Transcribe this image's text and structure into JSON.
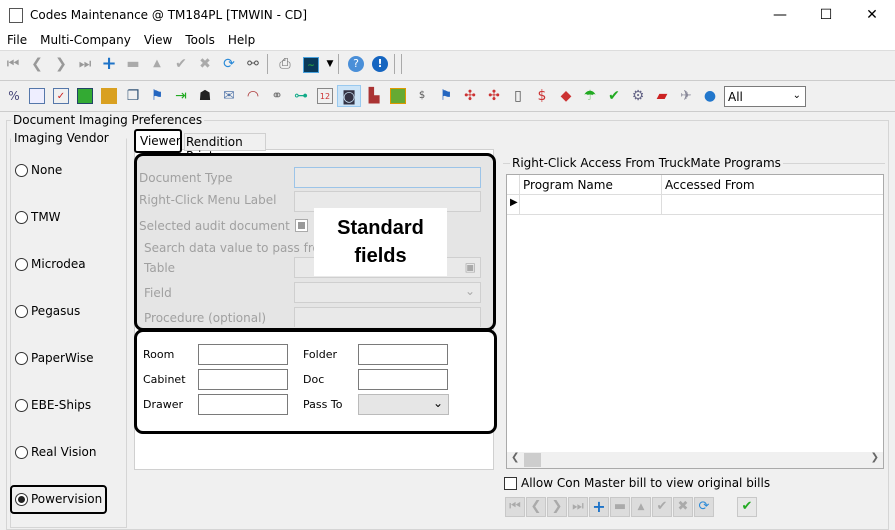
{
  "window": {
    "title": "Codes Maintenance @ TM184PL [TMWIN - CD]",
    "minimize": "—",
    "maximize": "☐",
    "close": "✕"
  },
  "menu": [
    "File",
    "Multi-Company",
    "View",
    "Tools",
    "Help"
  ],
  "toolbar2": {
    "filter_value": "All"
  },
  "group_title": "Document Imaging Preferences",
  "vendor": {
    "title": "Imaging Vendor",
    "options": [
      "None",
      "TMW",
      "Microdea",
      "Pegasus",
      "PaperWise",
      "EBE-Ships",
      "Real Vision",
      "Powervision"
    ],
    "selected": "Powervision"
  },
  "tabs": [
    "Viewer",
    "Rendition Print"
  ],
  "viewer": {
    "document_type": "Document Type",
    "menu_label": "Right-Click Menu Label",
    "selected_audit": "Selected audit document",
    "search_title": "Search data value to pass from TruckMate",
    "table": "Table",
    "field": "Field",
    "procedure": "Procedure (optional)",
    "annotation": "Standard fields",
    "room": "Room",
    "cabinet": "Cabinet",
    "drawer": "Drawer",
    "folder": "Folder",
    "doc": "Doc",
    "pass_to": "Pass To"
  },
  "right_click": {
    "title": "Right-Click Access From TruckMate Programs",
    "columns": [
      "Program Name",
      "Accessed From"
    ]
  },
  "allow_con_master": {
    "label": "Allow Con Master bill to view original bills",
    "checked": false
  }
}
